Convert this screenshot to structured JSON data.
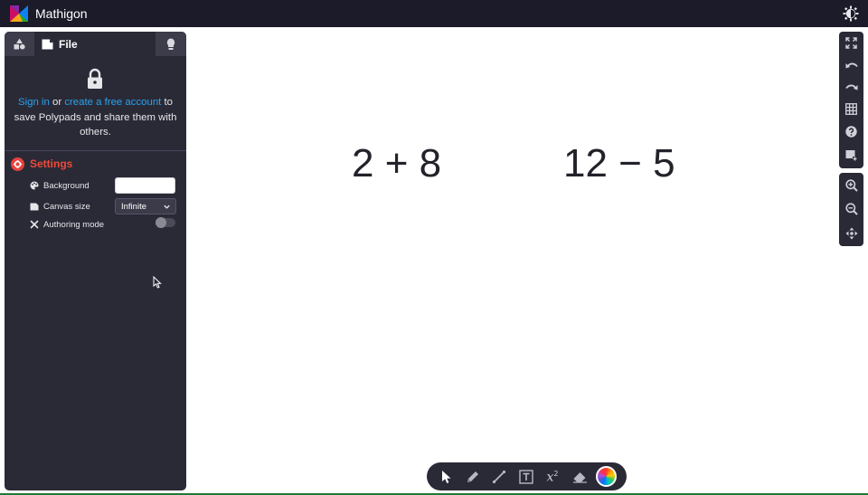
{
  "app": {
    "title": "Mathigon"
  },
  "sidebar": {
    "tabs": [
      {
        "name": "shapes",
        "icon": "shapes-icon"
      },
      {
        "name": "file",
        "label": "File",
        "icon": "file-icon"
      },
      {
        "name": "ideas",
        "icon": "lightbulb-icon"
      }
    ],
    "signin": {
      "sign_in": "Sign in",
      "or": " or ",
      "create_account": "create a free account",
      "rest": " to save Polypads and share them with others."
    },
    "settings": {
      "title": "Settings",
      "background_label": "Background",
      "background_value": "",
      "canvas_size_label": "Canvas size",
      "canvas_size_value": "Infinite",
      "authoring_label": "Authoring mode",
      "authoring_on": false
    }
  },
  "canvas": {
    "expressions": [
      "2 + 8",
      "12 − 5"
    ]
  },
  "right_toolbar": {
    "top": [
      "fullscreen-icon",
      "undo-icon",
      "redo-icon",
      "grid-icon",
      "help-icon",
      "add-slide-icon"
    ],
    "bottom": [
      "zoom-in-icon",
      "zoom-out-icon",
      "move-icon"
    ]
  },
  "palette": {
    "tools": [
      "select-icon",
      "pen-icon",
      "line-icon",
      "text-icon",
      "equation-icon",
      "eraser-icon",
      "color-wheel-icon"
    ],
    "equation_symbol": "x",
    "equation_exponent": "2"
  },
  "colors": {
    "topbar": "#1b1b29",
    "panel": "#2a2a37",
    "link": "#2aa2ee",
    "settings_accent": "#ee4a3a"
  }
}
